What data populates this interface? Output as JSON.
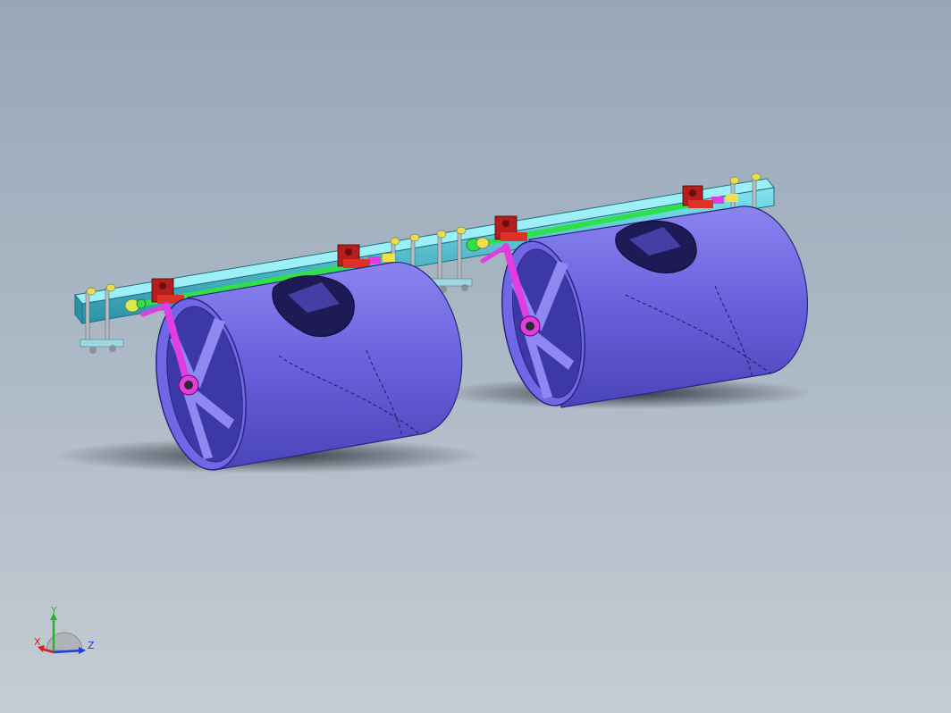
{
  "viewport": {
    "background_top": "#97a7b8",
    "background_bottom": "#c5ccd4"
  },
  "model": {
    "roller_color": "#6b63e0",
    "roller_dark": "#3e3aa6",
    "frame_color": "#3fb8c8",
    "shaft_color": "#2ee04a",
    "arm_color": "#e23de0",
    "bracket_color": "#c8201e",
    "collar_color": "#f0e04a"
  },
  "triad": {
    "x_label": "X",
    "y_label": "Y",
    "z_label": "Z",
    "x_color": "#d81e1e",
    "y_color": "#2fb02f",
    "z_color": "#1e3fd8"
  }
}
